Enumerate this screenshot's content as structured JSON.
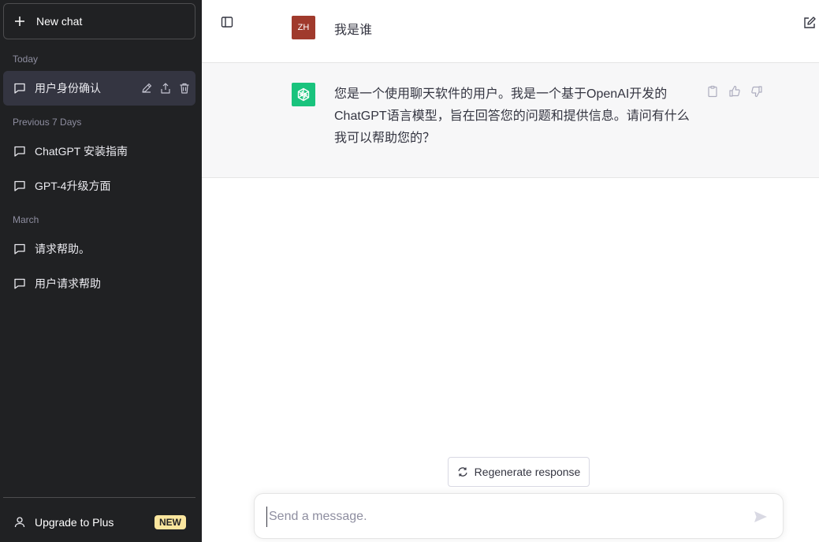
{
  "sidebar": {
    "new_chat_label": "New chat",
    "sections": [
      {
        "label": "Today"
      },
      {
        "label": "Previous 7 Days"
      },
      {
        "label": "March"
      }
    ],
    "conversations": [
      {
        "label": "用户身份确认",
        "active": true
      },
      {
        "label": "ChatGPT 安装指南"
      },
      {
        "label": "GPT-4升级方面"
      },
      {
        "label": "请求帮助。"
      },
      {
        "label": "用户请求帮助"
      }
    ],
    "upgrade_label": "Upgrade to Plus",
    "upgrade_badge": "NEW"
  },
  "thread": {
    "user_avatar": "ZH",
    "user_message": "我是谁",
    "assistant_message": "您是一个使用聊天软件的用户。我是一个基于OpenAI开发的ChatGPT语言模型，旨在回答您的问题和提供信息。请问有什么我可以帮助您的？"
  },
  "regenerate_label": "Regenerate response",
  "composer": {
    "placeholder": "Send a message."
  },
  "colors": {
    "sidebar_bg": "#202123",
    "user_avatar_bg": "#a03a2c",
    "assistant_avatar_bg": "#19c37d",
    "badge_bg": "#fae69e"
  },
  "icons": [
    "plus-icon",
    "chat-bubble-icon",
    "pencil-icon",
    "share-icon",
    "trash-icon",
    "user-icon",
    "sidebar-toggle-icon",
    "new-chat-edit-icon",
    "openai-logo-icon",
    "clipboard-icon",
    "thumbs-up-icon",
    "thumbs-down-icon",
    "refresh-icon",
    "send-icon"
  ]
}
